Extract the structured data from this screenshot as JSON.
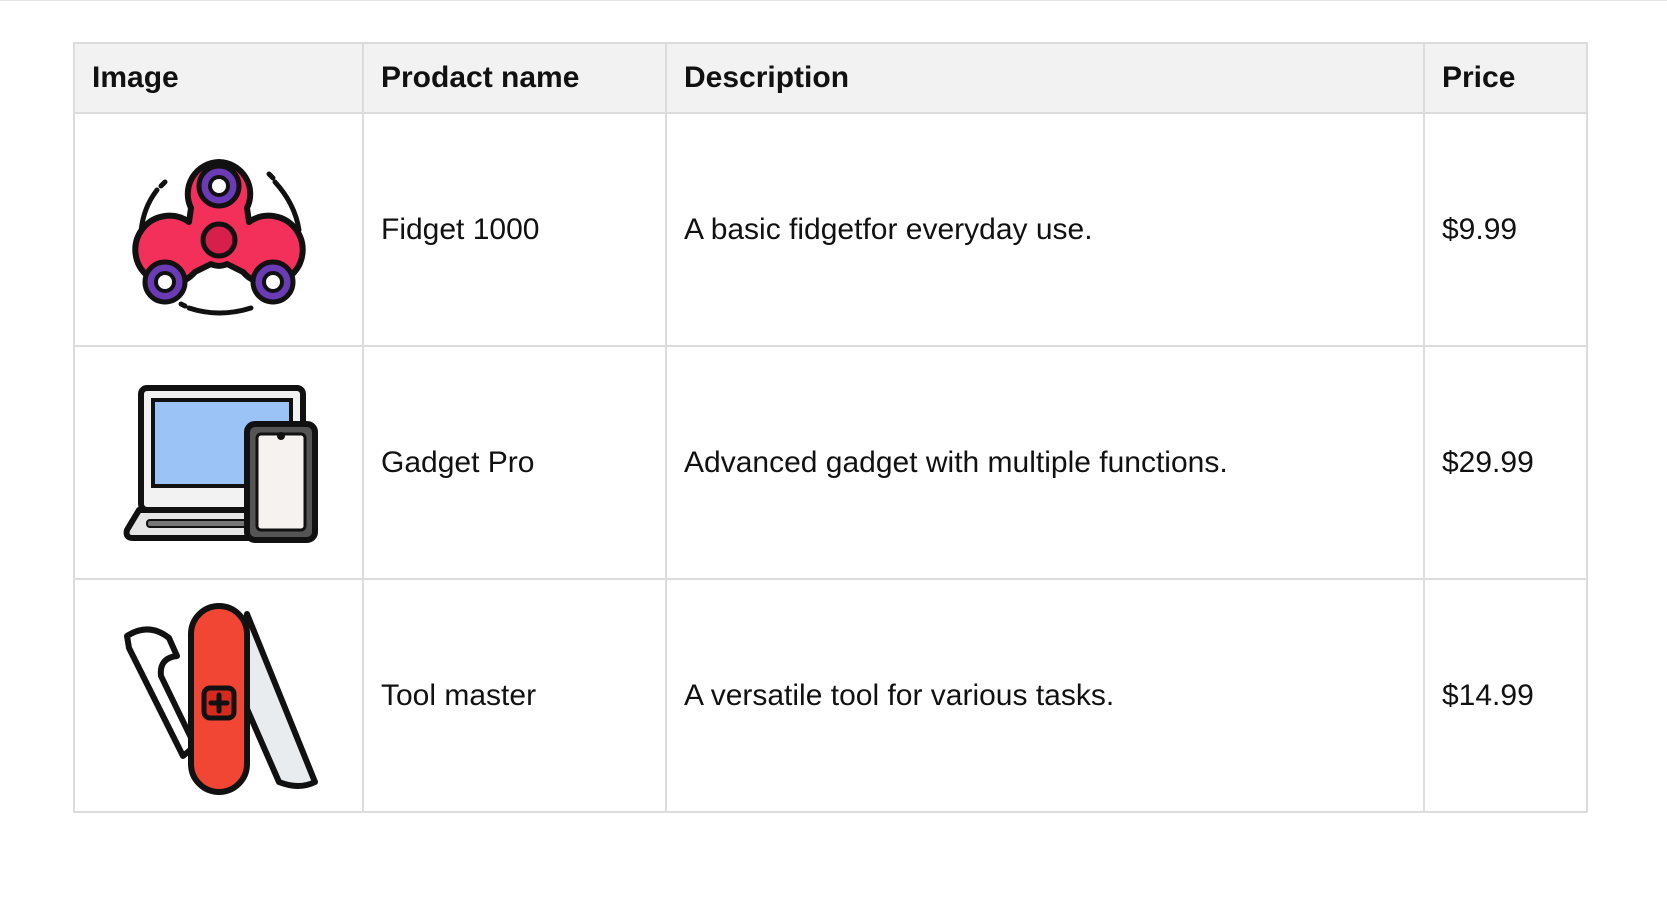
{
  "table": {
    "headers": {
      "image": "Image",
      "name": "Prodact name",
      "description": "Description",
      "price": "Price"
    },
    "rows": [
      {
        "icon": "fidget-spinner-icon",
        "name": "Fidget 1000",
        "description": "A basic fidgetfor everyday use.",
        "price": "$9.99"
      },
      {
        "icon": "laptop-phone-icon",
        "name": "Gadget Pro",
        "description": "Advanced gadget with multiple functions.",
        "price": "$29.99"
      },
      {
        "icon": "swiss-army-knife-icon",
        "name": "Tool master",
        "description": "A versatile tool for various tasks.",
        "price": "$14.99"
      }
    ]
  },
  "colors": {
    "header_bg": "#f2f2f2",
    "border": "#dcdcdc",
    "spinner_red": "#f2305a",
    "spinner_purple": "#6a3bb5",
    "screen_blue": "#9cc3f5",
    "knife_red": "#f24634"
  }
}
